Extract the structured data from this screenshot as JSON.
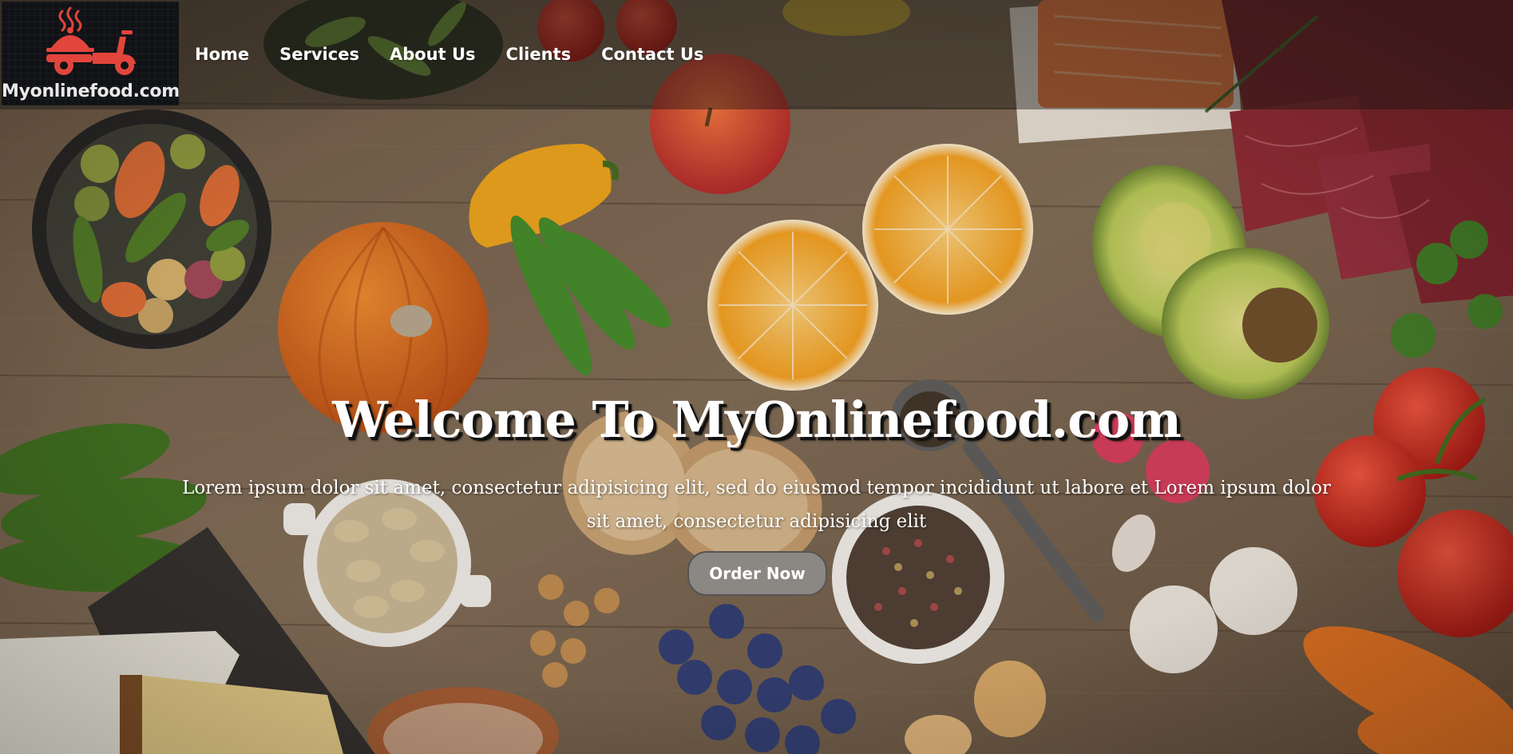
{
  "brand": {
    "name": "Myonlinefood.com",
    "logo_icon": "food-delivery-scooter-icon",
    "logo_color": "#e2453c"
  },
  "nav": {
    "items": [
      {
        "label": "Home"
      },
      {
        "label": "Services"
      },
      {
        "label": "About Us"
      },
      {
        "label": "Clients"
      },
      {
        "label": "Contact Us"
      }
    ]
  },
  "hero": {
    "title": "Welcome To MyOnlinefood.com",
    "subtitle": "Lorem ipsum dolor sit amet, consectetur adipisicing elit, sed do eiusmod tempor incididunt ut labore et Lorem ipsum dolor sit amet, consectetur adipisicing elit",
    "cta_label": "Order Now",
    "background": "rustic-wooden-table-with-fresh-groceries"
  },
  "colors": {
    "nav_overlay": "#141210",
    "cta_background": "#8b8783",
    "text": "#ffffff"
  }
}
